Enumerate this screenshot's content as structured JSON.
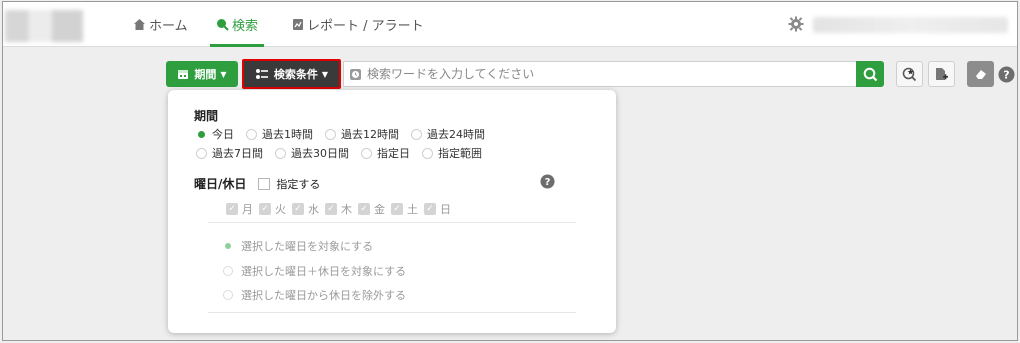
{
  "nav": {
    "home": "ホーム",
    "search": "検索",
    "report": "レポート / アラート"
  },
  "toolbar": {
    "period_label": "期間",
    "conditions_label": "検索条件",
    "search_placeholder": "検索ワードを入力してください"
  },
  "panel": {
    "period_title": "期間",
    "period_options": [
      "今日",
      "過去1時間",
      "過去12時間",
      "過去24時間",
      "過去7日間",
      "過去30日間",
      "指定日",
      "指定範囲"
    ],
    "period_selected": "今日",
    "weekday_title": "曜日/休日",
    "weekday_check_label": "指定する",
    "days": [
      "月",
      "火",
      "水",
      "木",
      "金",
      "土",
      "日"
    ],
    "weekday_modes": [
      "選択した曜日を対象にする",
      "選択した曜日＋休日を対象にする",
      "選択した曜日から休日を除外する"
    ]
  },
  "colors": {
    "accent": "#2e9e3e",
    "highlight_border": "#e00000",
    "dark_button": "#3a3a3a"
  },
  "icons": [
    "home-icon",
    "search-icon",
    "report-icon",
    "gear-icon",
    "calendar-icon",
    "filter-icon",
    "clock-icon",
    "magnifier-icon",
    "star-search-icon",
    "add-document-icon",
    "eraser-icon",
    "help-icon"
  ]
}
